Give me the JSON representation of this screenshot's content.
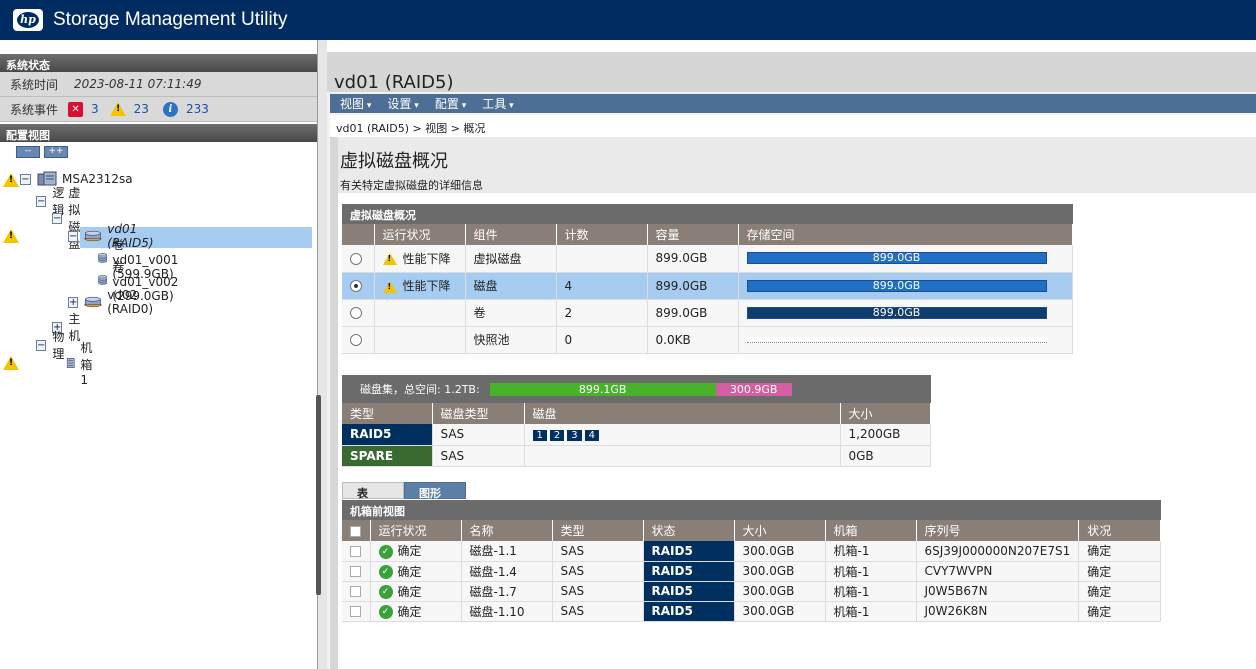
{
  "app": {
    "title": "Storage Management Utility",
    "logo": "hp"
  },
  "left": {
    "system_status_header": "系统状态",
    "system_time_label": "系统时间",
    "system_time": "2023-08-11 07:11:49",
    "system_events_label": "系统事件",
    "events": {
      "errors": "3",
      "warnings": "23",
      "info": "233"
    },
    "config_view_header": "配置视图",
    "collapse_all": "--",
    "expand_all": "++",
    "tree": {
      "root": "MSA2312sa",
      "logical": "逻辑",
      "vdisks": "虚拟磁盘",
      "vd01": "vd01 (RAID5)",
      "vol1": "卷vd01_v001 (599.9GB)",
      "vol2": "卷vd01_v002 (299.0GB)",
      "vd02": "vd02 (RAID0)",
      "hosts": "主机",
      "physical": "物理",
      "enclosure": "机箱1"
    }
  },
  "right": {
    "page_title": "vd01 (RAID5)",
    "menu": {
      "view": "视图",
      "settings": "设置",
      "config": "配置",
      "tools": "工具"
    },
    "breadcrumb": "vd01 (RAID5) > 视图 > 概况",
    "main_title": "虚拟磁盘概况",
    "main_desc": "有关特定虚拟磁盘的详细信息",
    "overview": {
      "title": "虚拟磁盘概况",
      "headers": [
        "运行状况",
        "组件",
        "计数",
        "容量",
        "存储空间"
      ],
      "rows": [
        {
          "status": "性能下降",
          "component": "虚拟磁盘",
          "count": "",
          "capacity": "899.0GB",
          "bar": "899.0GB"
        },
        {
          "status": "性能下降",
          "component": "磁盘",
          "count": "4",
          "capacity": "899.0GB",
          "bar": "899.0GB"
        },
        {
          "status": "",
          "component": "卷",
          "count": "2",
          "capacity": "899.0GB",
          "bar": "899.0GB"
        },
        {
          "status": "",
          "component": "快照池",
          "count": "0",
          "capacity": "0.0KB",
          "bar": ""
        }
      ]
    },
    "diskgroup": {
      "label": "磁盘集，总空间: 1.2TB:",
      "used": "899.1GB",
      "free": "300.9GB",
      "used_fraction": 0.749,
      "headers": [
        "类型",
        "磁盘类型",
        "磁盘",
        "大小"
      ],
      "rows": [
        {
          "type": "RAID5",
          "disk_type": "SAS",
          "disks": [
            "1",
            "2",
            "3",
            "4"
          ],
          "size": "1,200GB"
        },
        {
          "type": "SPARE",
          "disk_type": "SAS",
          "disks": [],
          "size": "0GB"
        }
      ]
    },
    "tabs": {
      "table": "表",
      "graphic": "图形"
    },
    "enclosure": {
      "title": "机箱前视图",
      "headers": [
        "运行状况",
        "名称",
        "类型",
        "状态",
        "大小",
        "机箱",
        "序列号",
        "状况"
      ],
      "rows": [
        {
          "health": "确定",
          "name": "磁盘-1.1",
          "type": "SAS",
          "state": "RAID5",
          "size": "300.0GB",
          "enclosure": "机箱-1",
          "serial": "6SJ39J000000N207E7S1",
          "condition": "确定"
        },
        {
          "health": "确定",
          "name": "磁盘-1.4",
          "type": "SAS",
          "state": "RAID5",
          "size": "300.0GB",
          "enclosure": "机箱-1",
          "serial": "CVY7WVPN",
          "condition": "确定"
        },
        {
          "health": "确定",
          "name": "磁盘-1.7",
          "type": "SAS",
          "state": "RAID5",
          "size": "300.0GB",
          "enclosure": "机箱-1",
          "serial": "J0W5B67N",
          "condition": "确定"
        },
        {
          "health": "确定",
          "name": "磁盘-1.10",
          "type": "SAS",
          "state": "RAID5",
          "size": "300.0GB",
          "enclosure": "机箱-1",
          "serial": "J0W26K8N",
          "condition": "确定"
        }
      ]
    }
  },
  "colors": {
    "header_bg": "#002c62",
    "menubar": "#4d6f96",
    "raid5": "#00305f",
    "spare": "#3a6a31",
    "used": "#49b22b",
    "free": "#d35fa3"
  }
}
